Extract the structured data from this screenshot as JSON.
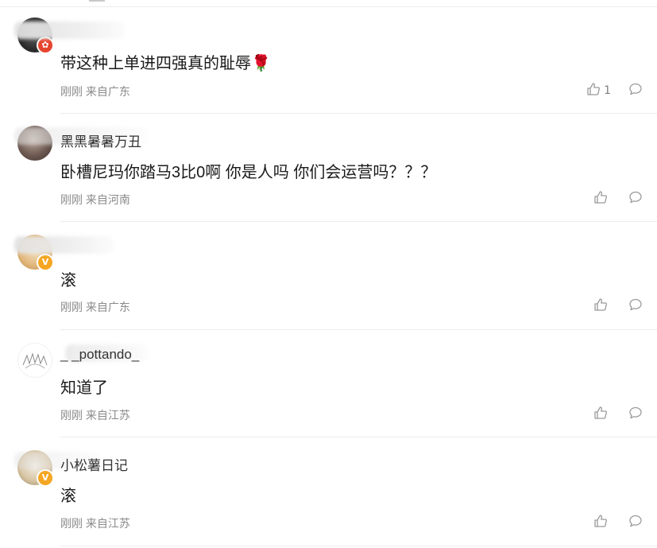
{
  "comments": [
    {
      "username": "",
      "avatar": "dark-portrait",
      "badge": "red-badge",
      "text": "带这种上单进四强真的耻辱🌹",
      "time": "刚刚",
      "location": "来自广东",
      "likes": "1"
    },
    {
      "username": "黑黑暑暑万丑",
      "avatar": "bear-portrait",
      "badge": "",
      "text": "卧槽尼玛你踏马3比0啊 你是人吗 你们会运营吗？？？",
      "time": "刚刚",
      "location": "来自河南",
      "likes": ""
    },
    {
      "username": "",
      "avatar": "food-photo",
      "badge": "gold-verified",
      "text": "滚",
      "time": "刚刚",
      "location": "来自广东",
      "likes": ""
    },
    {
      "username": "_ _pottando_",
      "avatar": "sketch-drawing",
      "badge": "",
      "text": "知道了",
      "time": "刚刚",
      "location": "来自江苏",
      "likes": ""
    },
    {
      "username": "小松薯日记",
      "avatar": "cat-photo",
      "badge": "gold-verified",
      "text": "滚",
      "time": "刚刚",
      "location": "来自江苏",
      "likes": ""
    }
  ],
  "icons": {
    "like": "thumbs-up-icon",
    "reply": "comment-bubble-icon",
    "verified": "verified-v-icon"
  },
  "colors": {
    "text_primary": "#1a1a1a",
    "text_meta": "#8a8a8a",
    "icon": "#9a9a9a",
    "divider": "#ececec",
    "verified_gold": "#f5a623",
    "badge_red": "#e6452f"
  }
}
